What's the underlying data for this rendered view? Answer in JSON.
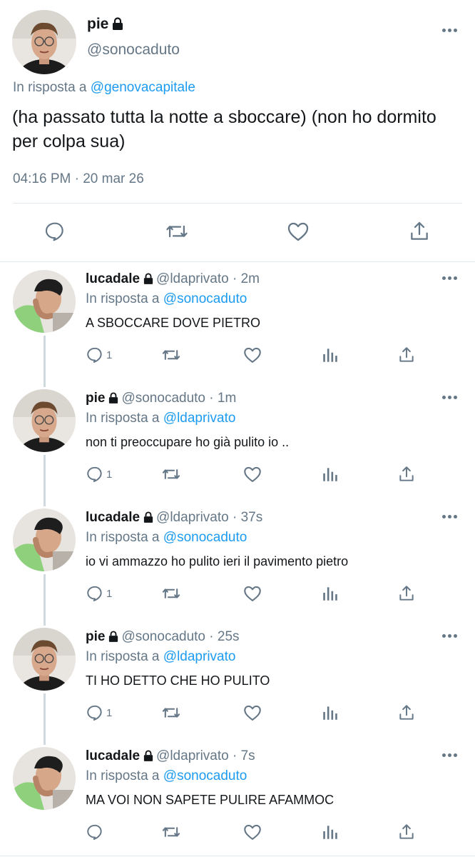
{
  "main_tweet": {
    "display_name": "pie",
    "handle": "@sonocaduto",
    "reply_prefix": "In risposta a",
    "reply_to": "@genovacapitale",
    "text": "(ha passato tutta la notte a sboccare) (non ho dormito per colpa sua)",
    "timestamp": "04:16 PM · 20 mar 26"
  },
  "replies": [
    {
      "display_name": "lucadale",
      "meta": "@ldaprivato · 2m",
      "reply_prefix": "In risposta a",
      "reply_to": "@sonocaduto",
      "text": "A SBOCCARE DOVE PIETRO",
      "reply_count": "1"
    },
    {
      "display_name": "pie",
      "meta": "@sonocaduto · 1m",
      "reply_prefix": "In risposta a",
      "reply_to": "@ldaprivato",
      "text": "non ti preoccupare ho già pulito io ..",
      "reply_count": "1"
    },
    {
      "display_name": "lucadale",
      "meta": "@ldaprivato · 37s",
      "reply_prefix": "In risposta a",
      "reply_to": "@sonocaduto",
      "text": "io vi ammazzo ho pulito ieri il pavimento pietro",
      "reply_count": "1"
    },
    {
      "display_name": "pie",
      "meta": "@sonocaduto · 25s",
      "reply_prefix": "In risposta a",
      "reply_to": "@ldaprivato",
      "text": "TI HO DETTO CHE HO PULITO",
      "reply_count": "1"
    },
    {
      "display_name": "lucadale",
      "meta": "@ldaprivato · 7s",
      "reply_prefix": "In risposta a",
      "reply_to": "@sonocaduto",
      "text": "MA VOI NON SAPETE PULIRE AFAMMOC",
      "reply_count": ""
    }
  ],
  "colors": {
    "link": "#1d9bf0",
    "secondary": "#657786",
    "divider": "#e1e8ed"
  },
  "icons": [
    "lock-icon",
    "more-icon",
    "reply-icon",
    "retweet-icon",
    "like-icon",
    "analytics-icon",
    "share-icon"
  ]
}
